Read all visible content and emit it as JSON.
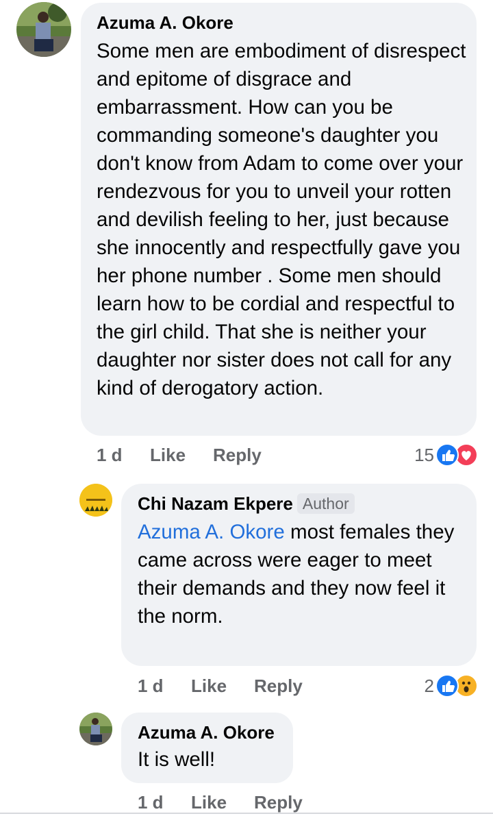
{
  "comments": [
    {
      "author": "Azuma A. Okore",
      "text": "Some men are embodiment of disrespect and epitome of disgrace and embarrassment. How can you be commanding someone's daughter you don't know from Adam to come over your rendezvous for you to unveil your rotten and devilish feeling to her, just because she innocently and respectfully gave you her phone number . Some men should learn how to be cordial and respectful to the girl child. That she is neither your daughter nor sister does not call for any kind of derogatory action.",
      "time": "1 d",
      "like_label": "Like",
      "reply_label": "Reply",
      "reaction_count": "15",
      "reactions": [
        "like",
        "love"
      ]
    },
    {
      "author": "Chi Nazam Ekpere",
      "badge": "Author",
      "mention": "Azuma A. Okore",
      "text": " most females they came across were eager to meet their demands and they now feel it the norm.",
      "time": "1 d",
      "like_label": "Like",
      "reply_label": "Reply",
      "reaction_count": "2",
      "reactions": [
        "like",
        "wow"
      ]
    },
    {
      "author": "Azuma A. Okore",
      "text": "It is well!",
      "time": "1 d",
      "like_label": "Like",
      "reply_label": "Reply"
    }
  ],
  "colors": {
    "bubble": "#f0f2f5",
    "mention": "#216fdb",
    "meta_text": "#65676b",
    "like_blue": "#1877f2",
    "love_red": "#f33e58",
    "wow_yellow": "#f7b125"
  }
}
